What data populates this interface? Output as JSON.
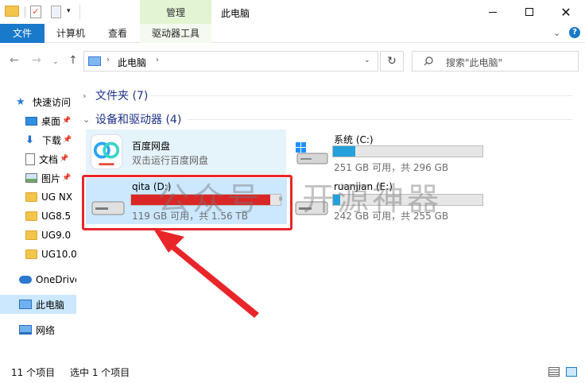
{
  "titlebar": {
    "context_tab": "管理",
    "window_title": "此电脑",
    "minimize_label": "",
    "maximize_label": "",
    "close_label": "✕"
  },
  "ribbon": {
    "tabs": [
      {
        "label": "文件"
      },
      {
        "label": "计算机"
      },
      {
        "label": "查看"
      },
      {
        "label": "驱动器工具"
      }
    ],
    "help_label": "?"
  },
  "address": {
    "path": "此电脑",
    "search_placeholder": "搜索\"此电脑\""
  },
  "sidebar": {
    "items": [
      {
        "label": "快速访问"
      },
      {
        "label": "桌面"
      },
      {
        "label": "下载"
      },
      {
        "label": "文档"
      },
      {
        "label": "图片"
      },
      {
        "label": "UG NX"
      },
      {
        "label": "UG8.5"
      },
      {
        "label": "UG9.0"
      },
      {
        "label": "UG10.0"
      },
      {
        "label": "OneDrive"
      },
      {
        "label": "此电脑"
      },
      {
        "label": "网络"
      }
    ]
  },
  "content": {
    "folders_header": "文件夹 (7)",
    "devices_header": "设备和驱动器 (4)",
    "baidu": {
      "name": "百度网盘",
      "subtitle": "双击运行百度网盘"
    },
    "drives": [
      {
        "name": "系统 (C:)",
        "info": "251 GB 可用，共 296 GB",
        "used_fraction": 0.15,
        "fill_color": "#26a0da"
      },
      {
        "name": "qita (D:)",
        "info": "119 GB 可用，共 1.56 TB",
        "used_fraction": 0.93,
        "fill_color": "#da2626"
      },
      {
        "name": "ruanjian (E:)",
        "info": "242 GB 可用，共 255 GB",
        "used_fraction": 0.05,
        "fill_color": "#26a0da"
      }
    ]
  },
  "watermark": "公众号 · 开源神器",
  "statusbar": {
    "item_count": "11 个项目",
    "selection": "选中 1 个项目"
  },
  "colors": {
    "accent": "#1979ca",
    "selection": "#cce8ff",
    "context_tab": "#e3f4d3",
    "highlight": "#e8262a"
  }
}
